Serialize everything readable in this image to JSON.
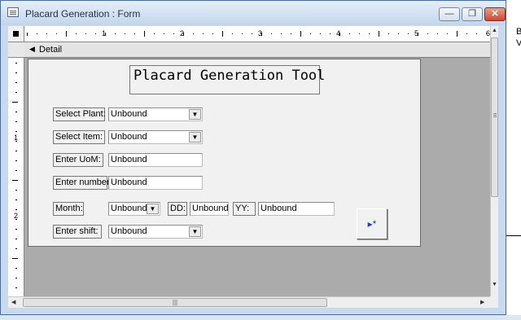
{
  "window": {
    "title": "Placard Generation : Form",
    "minimize": "—",
    "restore": "❐",
    "close": "✕"
  },
  "ruler": {
    "h_numbers": [
      "1",
      "2",
      "3",
      "4",
      "5",
      "6"
    ],
    "v_numbers": [
      "1",
      "2"
    ]
  },
  "section": {
    "label": "Detail",
    "arrow": "◀"
  },
  "form": {
    "heading": "Placard Generation Tool",
    "rows": {
      "plant": {
        "label": "Select Plant:",
        "value": "Unbound"
      },
      "item": {
        "label": "Select Item:",
        "value": "Unbound"
      },
      "uom": {
        "label": "Enter UoM:",
        "value": "Unbound"
      },
      "number": {
        "label": "Enter number",
        "value": "Unbound"
      },
      "month": {
        "label": "Month:",
        "value": "Unbound"
      },
      "dd": {
        "label": "DD:",
        "value": "Unbound"
      },
      "yy": {
        "label": "YY:",
        "value": "Unbound"
      },
      "shift": {
        "label": "Enter shift:",
        "value": "Unbound"
      }
    },
    "new_record_button": "▸*",
    "dropdown_glyph": "▼"
  },
  "outside": {
    "letter_top": "B",
    "glyph_below": "V"
  },
  "icons": {
    "window": "form-window-icon",
    "section_toggle": "section-collapse-icon",
    "scroll_up": "scroll-up-arrow-icon",
    "scroll_down": "scroll-down-arrow-icon",
    "scroll_left": "scroll-left-arrow-icon",
    "scroll_right": "scroll-right-arrow-icon"
  }
}
